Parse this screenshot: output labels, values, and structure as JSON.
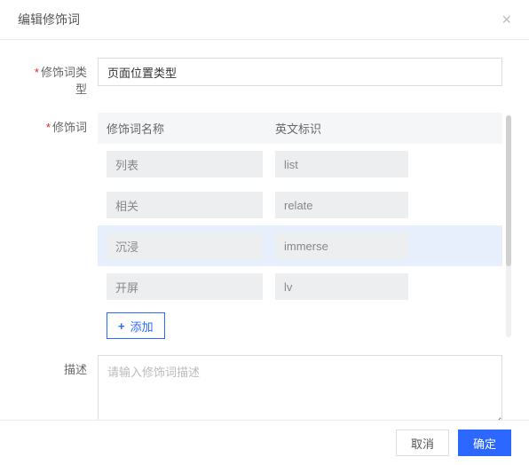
{
  "header": {
    "title": "编辑修饰词",
    "close": "×"
  },
  "labels": {
    "type": "修饰词类型",
    "modifier": "修饰词",
    "desc": "描述"
  },
  "form": {
    "type_value": "页面位置类型",
    "desc_placeholder": "请输入修饰词描述"
  },
  "list": {
    "head_name": "修饰词名称",
    "head_en": "英文标识",
    "rows": [
      {
        "name": "列表",
        "en": "list",
        "highlight": false
      },
      {
        "name": "相关",
        "en": "relate",
        "highlight": false
      },
      {
        "name": "沉浸",
        "en": "immerse",
        "highlight": true
      },
      {
        "name": "开屏",
        "en": "lv",
        "highlight": false
      }
    ],
    "add_label": "添加"
  },
  "footer": {
    "cancel": "取消",
    "confirm": "确定"
  }
}
